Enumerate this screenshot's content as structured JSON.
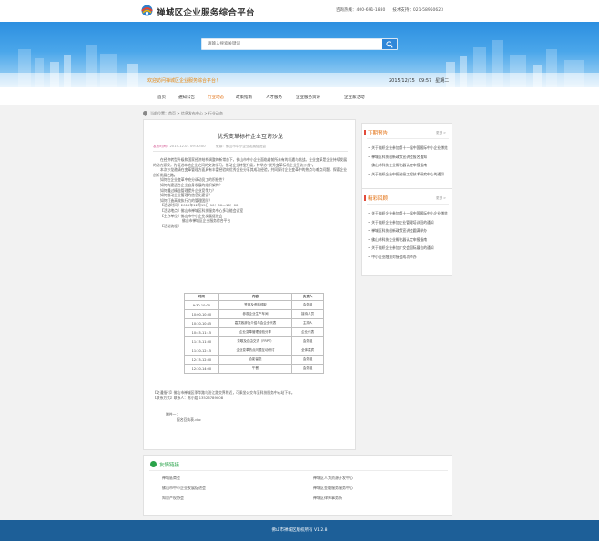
{
  "header": {
    "site_title": "禅城区企业服务综合平台",
    "hotline": "咨询热线：400-691-1880",
    "tech_support": "技术支持：021-58950623"
  },
  "search": {
    "placeholder": "请输入搜索关键词"
  },
  "welcome_text": "欢迎访问禅城区企业服务综合平台！",
  "date": {
    "date": "2015/12/15",
    "time": "09:57",
    "weekday": "星期二"
  },
  "nav": {
    "items": [
      {
        "label": "首页"
      },
      {
        "label": "通知公告"
      },
      {
        "label": "行业动态"
      },
      {
        "label": "政策指南"
      },
      {
        "label": "人才服务"
      },
      {
        "label": "企业服务资讯"
      },
      {
        "label": "企业家活动"
      }
    ],
    "active_index": 2
  },
  "breadcrumb": {
    "prefix": "当前位置：",
    "home": "首页",
    "sep": ">",
    "section": "信息发布中心",
    "page": "行业动态"
  },
  "article": {
    "title": "优秀变革标杆企业互访沙龙",
    "publish_label": "发布时间：",
    "publish_time": "2015-12-01 09:30:00",
    "source_label": "来源：",
    "source": "佛山市中小企业发展促进会",
    "paragraphs": [
      "在经济转型升级和国家经济结构调整的新常态下，佛山市中小企业面临着前所未有的机遇与挑战。企业变革是企业持续发展的动力源泉，为促进本地企业之间的交流学习，推动企业转型升级，特举办“优秀变革标杆企业互访沙龙”。",
      "本次沙龙邀请在变革管理方面具有丰富经验的优秀企业分享其成功经验，共同探讨企业变革中的热点与难点问题，探索企业创新发展之路。"
    ],
    "questions": [
      "如何在企业变革中充分调动员工的积极性？",
      "如何构建适合企业自身发展的组织架构？",
      "如何通过精益管理提升企业竞争力？",
      "如何推动企业管理的信息化建设？",
      "如何打造高效执行力的管理团队？"
    ],
    "fields": {
      "time_label": "【活动时间】",
      "time": "2015年12月15日 10：00—16：00",
      "place_label": "【活动地点】",
      "place": "佛山市禅城区科技服务中心多功能会议室",
      "organizer_label": "【主办单位】",
      "organizer": "佛山市中小企业发展促进会",
      "co_organizer": "佛山市禅城区企业服务综合平台",
      "flow_label": "【活动流程】"
    },
    "schedule": {
      "headers": [
        "时间",
        "内容",
        "负责人"
      ],
      "rows": [
        [
          "9:30-10:00",
          "签到及资料领取",
          "会务组"
        ],
        [
          "10:00-10:30",
          "参观企业生产车间",
          "接待人员"
        ],
        [
          "10:30-10:45",
          "嘉宾致辞及介绍与会企业代表",
          "主持人"
        ],
        [
          "10:45-11:15",
          "企业变革管理经验分享",
          "企业代表"
        ],
        [
          "11:15-11:30",
          "茶歇及自由交流（FRPT）",
          "会务组"
        ],
        [
          "11:30-12:15",
          "企业变革热点问题互动研讨",
          "全体嘉宾"
        ],
        [
          "12:15-12:30",
          "合影留念",
          "会务组"
        ],
        [
          "12:30-14:00",
          "午餐",
          "会务组"
        ]
      ]
    },
    "traffic_label": "【交通指引】",
    "traffic": "佛山市禅城区季华路与汾江路交界附近，可乘坐公交车至科技服务中心站下车。",
    "contact_label": "【联系方式】",
    "contact": "联系人：陈小姐  13526789008",
    "attachment_label": "附件一：",
    "attachment": "报名回执表.doc"
  },
  "notices": {
    "title": "下期预告",
    "more": "更多 >",
    "items": [
      "关于组织企业参加第十一届中国国际中小企业博览会的通知",
      "禅城区科技创新政策宣讲会报名通知",
      "佛山市科技企业孵化器认定申报指南",
      "关于组织企业申报省级工程技术研究中心的通知"
    ]
  },
  "highlights": {
    "title": "精彩回顾",
    "more": "更多 >",
    "items": [
      "关于组织企业参加第十一届中国国际中小企业博览会的通知",
      "关于组织企业参加企业管理培训班的通知",
      "禅城区科技创新政策宣讲会圆满举办",
      "佛山市科技企业孵化器认定申报指南",
      "关于组织企业参加广交会国际展位的通知",
      "中小企业融资对接会成功举办"
    ]
  },
  "friend_links": {
    "title": "友情链接",
    "items": [
      "禅城區商会",
      "禅城区人力资源开发中心",
      "佛山市中小企业发展促进会",
      "禅城区金融服务服务中心",
      "知识产权协会",
      "禅城区律师事务所"
    ]
  },
  "footer": {
    "text": "佛山市禅城区版权所有 V1.2.8"
  }
}
